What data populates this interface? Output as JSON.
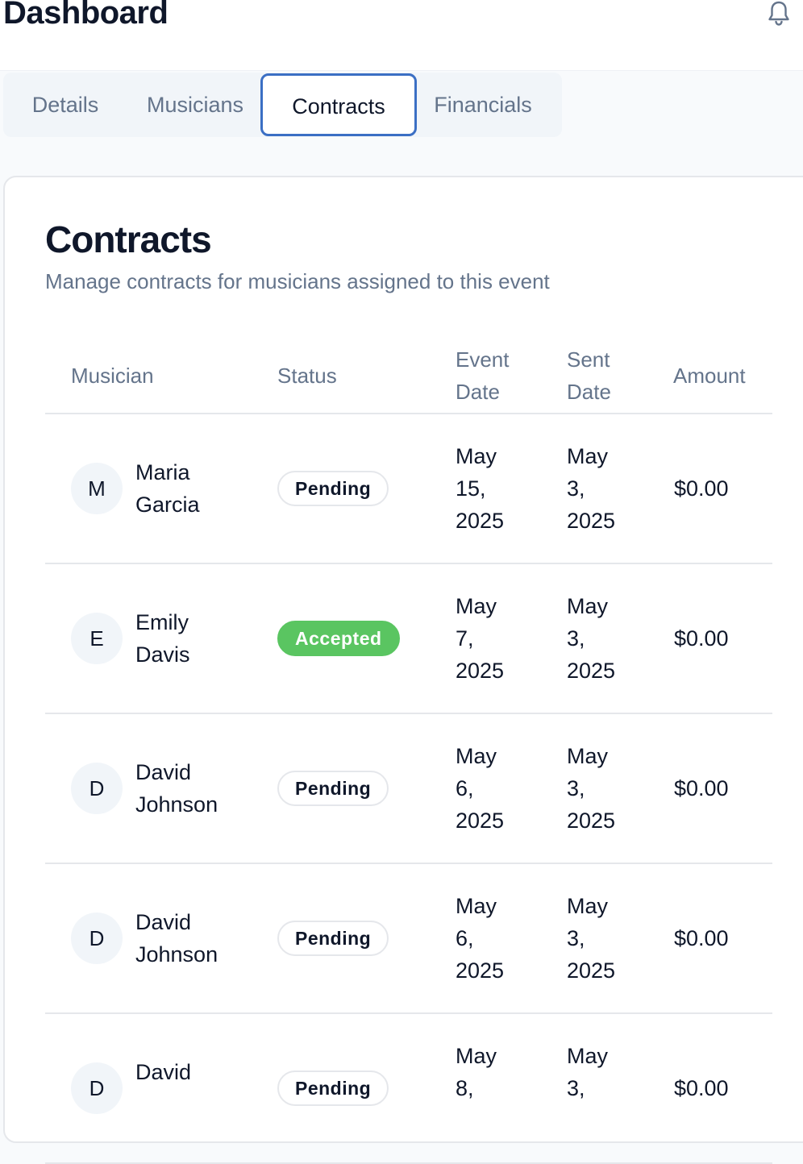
{
  "header": {
    "title": "Dashboard",
    "icon": "bell-icon"
  },
  "tabs": [
    {
      "label": "Details",
      "active": false
    },
    {
      "label": "Musicians",
      "active": false
    },
    {
      "label": "Contracts",
      "active": true
    },
    {
      "label": "Financials",
      "active": false
    }
  ],
  "card": {
    "title": "Contracts",
    "subtitle": "Manage contracts for musicians assigned to this event"
  },
  "table": {
    "columns": {
      "musician": "Musician",
      "status": "Status",
      "event_date": [
        "Event",
        "Date"
      ],
      "sent_date": [
        "Sent",
        "Date"
      ],
      "amount": "Amount"
    },
    "rows": [
      {
        "initial": "M",
        "name": [
          "Maria",
          "Garcia"
        ],
        "status": "Pending",
        "event_date": [
          "May",
          "15,",
          "2025"
        ],
        "sent_date": [
          "May",
          "3,",
          "2025"
        ],
        "amount": "$0.00"
      },
      {
        "initial": "E",
        "name": [
          "Emily",
          "Davis"
        ],
        "status": "Accepted",
        "event_date": [
          "May",
          "7,",
          "2025"
        ],
        "sent_date": [
          "May",
          "3,",
          "2025"
        ],
        "amount": "$0.00"
      },
      {
        "initial": "D",
        "name": [
          "David",
          "Johnson"
        ],
        "status": "Pending",
        "event_date": [
          "May",
          "6,",
          "2025"
        ],
        "sent_date": [
          "May",
          "3,",
          "2025"
        ],
        "amount": "$0.00"
      },
      {
        "initial": "D",
        "name": [
          "David",
          "Johnson"
        ],
        "status": "Pending",
        "event_date": [
          "May",
          "6,",
          "2025"
        ],
        "sent_date": [
          "May",
          "3,",
          "2025"
        ],
        "amount": "$0.00"
      },
      {
        "initial": "D",
        "name": [
          "David",
          ""
        ],
        "status": "Pending",
        "event_date": [
          "May",
          "8,",
          ""
        ],
        "sent_date": [
          "May",
          "3,",
          ""
        ],
        "amount": "$0.00"
      }
    ]
  },
  "colors": {
    "accent": "#3b6fc4",
    "accepted": "#5ac561",
    "muted": "#64748b"
  }
}
